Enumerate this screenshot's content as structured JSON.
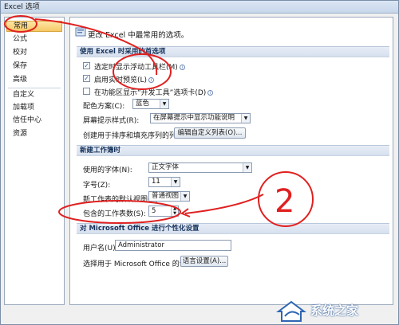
{
  "window": {
    "title": "Excel 选项"
  },
  "sidebar": {
    "items": [
      {
        "label": "常用",
        "active": true
      },
      {
        "label": "公式"
      },
      {
        "label": "校对"
      },
      {
        "label": "保存"
      },
      {
        "label": "高级"
      },
      {
        "label": "自定义"
      },
      {
        "label": "加载项"
      },
      {
        "label": "信任中心"
      },
      {
        "label": "资源"
      }
    ]
  },
  "content": {
    "headline": "更改 Excel 中最常用的选项。",
    "section1": {
      "title": "使用 Excel 时采用的首选项",
      "checkbox1": {
        "label": "选定时显示浮动工具栏(M)",
        "checked": true
      },
      "checkbox2": {
        "label": "启用实时预览(L)",
        "checked": true
      },
      "checkbox3": {
        "label": "在功能区显示“开发工具”选项卡(D)",
        "checked": false
      },
      "color_scheme_label": "配色方案(C):",
      "color_scheme_value": "蓝色",
      "tip_style_label": "屏幕提示样式(R):",
      "tip_style_value": "在屏幕提示中显示功能说明",
      "custom_list_label": "创建用于排序和填充序列的列表:",
      "custom_list_button": "编辑自定义列表(O)..."
    },
    "section2": {
      "title": "新建工作簿时",
      "font_label": "使用的字体(N):",
      "font_value": "正文字体",
      "size_label": "字号(Z):",
      "size_value": "11",
      "view_label": "新工作表的默认视图(V):",
      "view_value": "普通视图",
      "sheets_label": "包含的工作表数(S):",
      "sheets_value": "5"
    },
    "section3": {
      "title": "对 Microsoft Office 进行个性化设置",
      "username_label": "用户名(U):",
      "username_value": "Administrator",
      "language_label": "选择用于 Microsoft Office 的语言:",
      "language_button": "语言设置(A)..."
    }
  },
  "annotation": {
    "circle_number": "2"
  },
  "watermark": {
    "text": "系统之家"
  },
  "colors": {
    "accent": "#e02020",
    "active_item": "#f6c866",
    "header": "#15315a"
  }
}
